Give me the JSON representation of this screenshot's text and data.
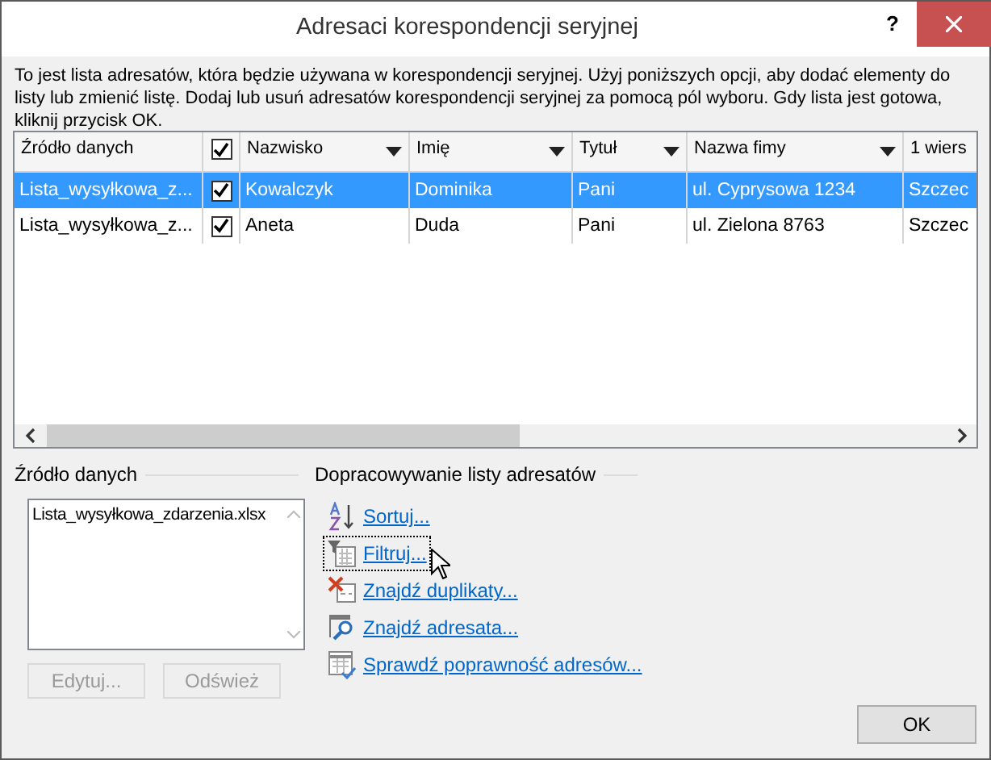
{
  "window": {
    "title": "Adresaci korespondencji seryjnej",
    "help": "?"
  },
  "description": "To jest lista adresatów, która będzie używana w korespondencji seryjnej. Użyj poniższych opcji, aby dodać elementy do listy lub zmienić listę. Dodaj lub usuń adresatów korespondencji seryjnej za pomocą pól wyboru. Gdy lista jest gotowa, kliknij przycisk OK.",
  "table": {
    "columns": [
      {
        "kind": "text",
        "label": "Źródło danych",
        "filter": false
      },
      {
        "kind": "checkbox",
        "checked": true
      },
      {
        "kind": "text",
        "label": "Nazwisko",
        "filter": true
      },
      {
        "kind": "text",
        "label": "Imię",
        "filter": true
      },
      {
        "kind": "text",
        "label": "Tytuł",
        "filter": true
      },
      {
        "kind": "text",
        "label": "Nazwa fimy",
        "filter": true
      },
      {
        "kind": "text",
        "label": "1 wiers",
        "filter": false
      }
    ],
    "rows": [
      {
        "selected": true,
        "checked": true,
        "cells": [
          "Lista_wysyłkowa_z...",
          "",
          "Kowalczyk",
          "Dominika",
          "Pani",
          "ul. Cyprysowa 1234",
          "Szczec"
        ]
      },
      {
        "selected": false,
        "checked": true,
        "cells": [
          "Lista_wysyłkowa_z...",
          "",
          "Aneta",
          "Duda",
          "Pani",
          "ul. Zielona 8763",
          "Szczec"
        ]
      }
    ]
  },
  "data_source": {
    "title": "Źródło danych",
    "files": [
      "Lista_wysyłkowa_zdarzenia.xlsx"
    ],
    "buttons": [
      {
        "label": "Edytuj...",
        "disabled": true
      },
      {
        "label": "Odśwież",
        "disabled": true
      }
    ]
  },
  "refine": {
    "title": "Dopracowywanie listy adresatów",
    "links": [
      {
        "kind": "sort",
        "label": "Sortuj...",
        "focused": false
      },
      {
        "kind": "filter",
        "label": "Filtruj...",
        "focused": true
      },
      {
        "kind": "duplicates",
        "label": "Znajdź duplikaty...",
        "focused": false
      },
      {
        "kind": "find",
        "label": "Znajdź adresata...",
        "focused": false
      },
      {
        "kind": "validate",
        "label": "Sprawdź poprawność adresów...",
        "focused": false
      }
    ]
  },
  "ok_button": "OK"
}
